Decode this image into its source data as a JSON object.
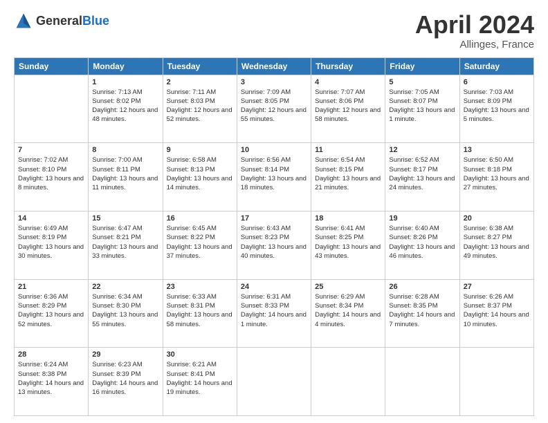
{
  "header": {
    "logo_general": "General",
    "logo_blue": "Blue",
    "month_title": "April 2024",
    "location": "Allinges, France"
  },
  "weekdays": [
    "Sunday",
    "Monday",
    "Tuesday",
    "Wednesday",
    "Thursday",
    "Friday",
    "Saturday"
  ],
  "weeks": [
    [
      {
        "day": null,
        "info": null
      },
      {
        "day": "1",
        "sunrise": "Sunrise: 7:13 AM",
        "sunset": "Sunset: 8:02 PM",
        "daylight": "Daylight: 12 hours and 48 minutes."
      },
      {
        "day": "2",
        "sunrise": "Sunrise: 7:11 AM",
        "sunset": "Sunset: 8:03 PM",
        "daylight": "Daylight: 12 hours and 52 minutes."
      },
      {
        "day": "3",
        "sunrise": "Sunrise: 7:09 AM",
        "sunset": "Sunset: 8:05 PM",
        "daylight": "Daylight: 12 hours and 55 minutes."
      },
      {
        "day": "4",
        "sunrise": "Sunrise: 7:07 AM",
        "sunset": "Sunset: 8:06 PM",
        "daylight": "Daylight: 12 hours and 58 minutes."
      },
      {
        "day": "5",
        "sunrise": "Sunrise: 7:05 AM",
        "sunset": "Sunset: 8:07 PM",
        "daylight": "Daylight: 13 hours and 1 minute."
      },
      {
        "day": "6",
        "sunrise": "Sunrise: 7:03 AM",
        "sunset": "Sunset: 8:09 PM",
        "daylight": "Daylight: 13 hours and 5 minutes."
      }
    ],
    [
      {
        "day": "7",
        "sunrise": "Sunrise: 7:02 AM",
        "sunset": "Sunset: 8:10 PM",
        "daylight": "Daylight: 13 hours and 8 minutes."
      },
      {
        "day": "8",
        "sunrise": "Sunrise: 7:00 AM",
        "sunset": "Sunset: 8:11 PM",
        "daylight": "Daylight: 13 hours and 11 minutes."
      },
      {
        "day": "9",
        "sunrise": "Sunrise: 6:58 AM",
        "sunset": "Sunset: 8:13 PM",
        "daylight": "Daylight: 13 hours and 14 minutes."
      },
      {
        "day": "10",
        "sunrise": "Sunrise: 6:56 AM",
        "sunset": "Sunset: 8:14 PM",
        "daylight": "Daylight: 13 hours and 18 minutes."
      },
      {
        "day": "11",
        "sunrise": "Sunrise: 6:54 AM",
        "sunset": "Sunset: 8:15 PM",
        "daylight": "Daylight: 13 hours and 21 minutes."
      },
      {
        "day": "12",
        "sunrise": "Sunrise: 6:52 AM",
        "sunset": "Sunset: 8:17 PM",
        "daylight": "Daylight: 13 hours and 24 minutes."
      },
      {
        "day": "13",
        "sunrise": "Sunrise: 6:50 AM",
        "sunset": "Sunset: 8:18 PM",
        "daylight": "Daylight: 13 hours and 27 minutes."
      }
    ],
    [
      {
        "day": "14",
        "sunrise": "Sunrise: 6:49 AM",
        "sunset": "Sunset: 8:19 PM",
        "daylight": "Daylight: 13 hours and 30 minutes."
      },
      {
        "day": "15",
        "sunrise": "Sunrise: 6:47 AM",
        "sunset": "Sunset: 8:21 PM",
        "daylight": "Daylight: 13 hours and 33 minutes."
      },
      {
        "day": "16",
        "sunrise": "Sunrise: 6:45 AM",
        "sunset": "Sunset: 8:22 PM",
        "daylight": "Daylight: 13 hours and 37 minutes."
      },
      {
        "day": "17",
        "sunrise": "Sunrise: 6:43 AM",
        "sunset": "Sunset: 8:23 PM",
        "daylight": "Daylight: 13 hours and 40 minutes."
      },
      {
        "day": "18",
        "sunrise": "Sunrise: 6:41 AM",
        "sunset": "Sunset: 8:25 PM",
        "daylight": "Daylight: 13 hours and 43 minutes."
      },
      {
        "day": "19",
        "sunrise": "Sunrise: 6:40 AM",
        "sunset": "Sunset: 8:26 PM",
        "daylight": "Daylight: 13 hours and 46 minutes."
      },
      {
        "day": "20",
        "sunrise": "Sunrise: 6:38 AM",
        "sunset": "Sunset: 8:27 PM",
        "daylight": "Daylight: 13 hours and 49 minutes."
      }
    ],
    [
      {
        "day": "21",
        "sunrise": "Sunrise: 6:36 AM",
        "sunset": "Sunset: 8:29 PM",
        "daylight": "Daylight: 13 hours and 52 minutes."
      },
      {
        "day": "22",
        "sunrise": "Sunrise: 6:34 AM",
        "sunset": "Sunset: 8:30 PM",
        "daylight": "Daylight: 13 hours and 55 minutes."
      },
      {
        "day": "23",
        "sunrise": "Sunrise: 6:33 AM",
        "sunset": "Sunset: 8:31 PM",
        "daylight": "Daylight: 13 hours and 58 minutes."
      },
      {
        "day": "24",
        "sunrise": "Sunrise: 6:31 AM",
        "sunset": "Sunset: 8:33 PM",
        "daylight": "Daylight: 14 hours and 1 minute."
      },
      {
        "day": "25",
        "sunrise": "Sunrise: 6:29 AM",
        "sunset": "Sunset: 8:34 PM",
        "daylight": "Daylight: 14 hours and 4 minutes."
      },
      {
        "day": "26",
        "sunrise": "Sunrise: 6:28 AM",
        "sunset": "Sunset: 8:35 PM",
        "daylight": "Daylight: 14 hours and 7 minutes."
      },
      {
        "day": "27",
        "sunrise": "Sunrise: 6:26 AM",
        "sunset": "Sunset: 8:37 PM",
        "daylight": "Daylight: 14 hours and 10 minutes."
      }
    ],
    [
      {
        "day": "28",
        "sunrise": "Sunrise: 6:24 AM",
        "sunset": "Sunset: 8:38 PM",
        "daylight": "Daylight: 14 hours and 13 minutes."
      },
      {
        "day": "29",
        "sunrise": "Sunrise: 6:23 AM",
        "sunset": "Sunset: 8:39 PM",
        "daylight": "Daylight: 14 hours and 16 minutes."
      },
      {
        "day": "30",
        "sunrise": "Sunrise: 6:21 AM",
        "sunset": "Sunset: 8:41 PM",
        "daylight": "Daylight: 14 hours and 19 minutes."
      },
      {
        "day": null,
        "info": null
      },
      {
        "day": null,
        "info": null
      },
      {
        "day": null,
        "info": null
      },
      {
        "day": null,
        "info": null
      }
    ]
  ]
}
